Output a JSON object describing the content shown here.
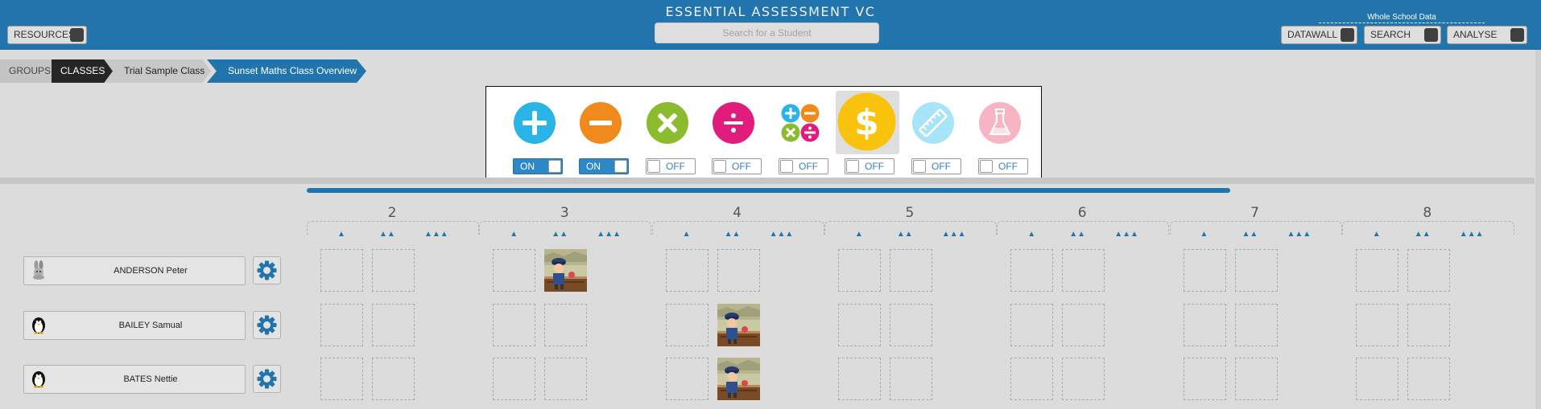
{
  "header": {
    "title": "ESSENTIAL ASSESSMENT VC",
    "search_placeholder": "Search for a Student",
    "resources_label": "RESOURCES",
    "whole_school_label": "Whole School Data",
    "datawall_label": "DATAWALL",
    "search_label": "SEARCH",
    "analyse_label": "ANALYSE"
  },
  "breadcrumb": {
    "groups": "GROUPS",
    "classes": "CLASSES",
    "class_name": "Trial Sample Class",
    "overview": "Sunset Maths Class Overview"
  },
  "strands": [
    {
      "icon": "addition-icon",
      "color": "#29b3e6",
      "state": "ON"
    },
    {
      "icon": "subtraction-icon",
      "color": "#f08a1c",
      "state": "ON"
    },
    {
      "icon": "multiplication-icon",
      "color": "#8bbc2f",
      "state": "OFF"
    },
    {
      "icon": "division-icon",
      "color": "#e01c7c",
      "state": "OFF"
    },
    {
      "icon": "mixed-operations-icon",
      "color": "#f08a1c",
      "state": "OFF"
    },
    {
      "icon": "money-icon",
      "color": "#f9c20c",
      "state": "OFF"
    },
    {
      "icon": "measurement-ruler-icon",
      "color": "#a6e4f7",
      "state": "OFF"
    },
    {
      "icon": "flask-icon",
      "color": "#f7b4c2",
      "state": "OFF"
    }
  ],
  "levels": [
    "2",
    "3",
    "4",
    "5",
    "6",
    "7",
    "8"
  ],
  "sublevel_markers": [
    "▲",
    "▲▲",
    "▲▲▲"
  ],
  "students": [
    {
      "name": "ANDERSON Peter",
      "avatar": "rabbit-icon",
      "progress_cell": {
        "level": "3",
        "sublevel": 1
      }
    },
    {
      "name": "BAILEY Samual",
      "avatar": "penguin-icon",
      "progress_cell": {
        "level": "4",
        "sublevel": 1
      }
    },
    {
      "name": "BATES Nettie",
      "avatar": "penguin-icon",
      "progress_cell": {
        "level": "4",
        "sublevel": 1
      }
    }
  ]
}
